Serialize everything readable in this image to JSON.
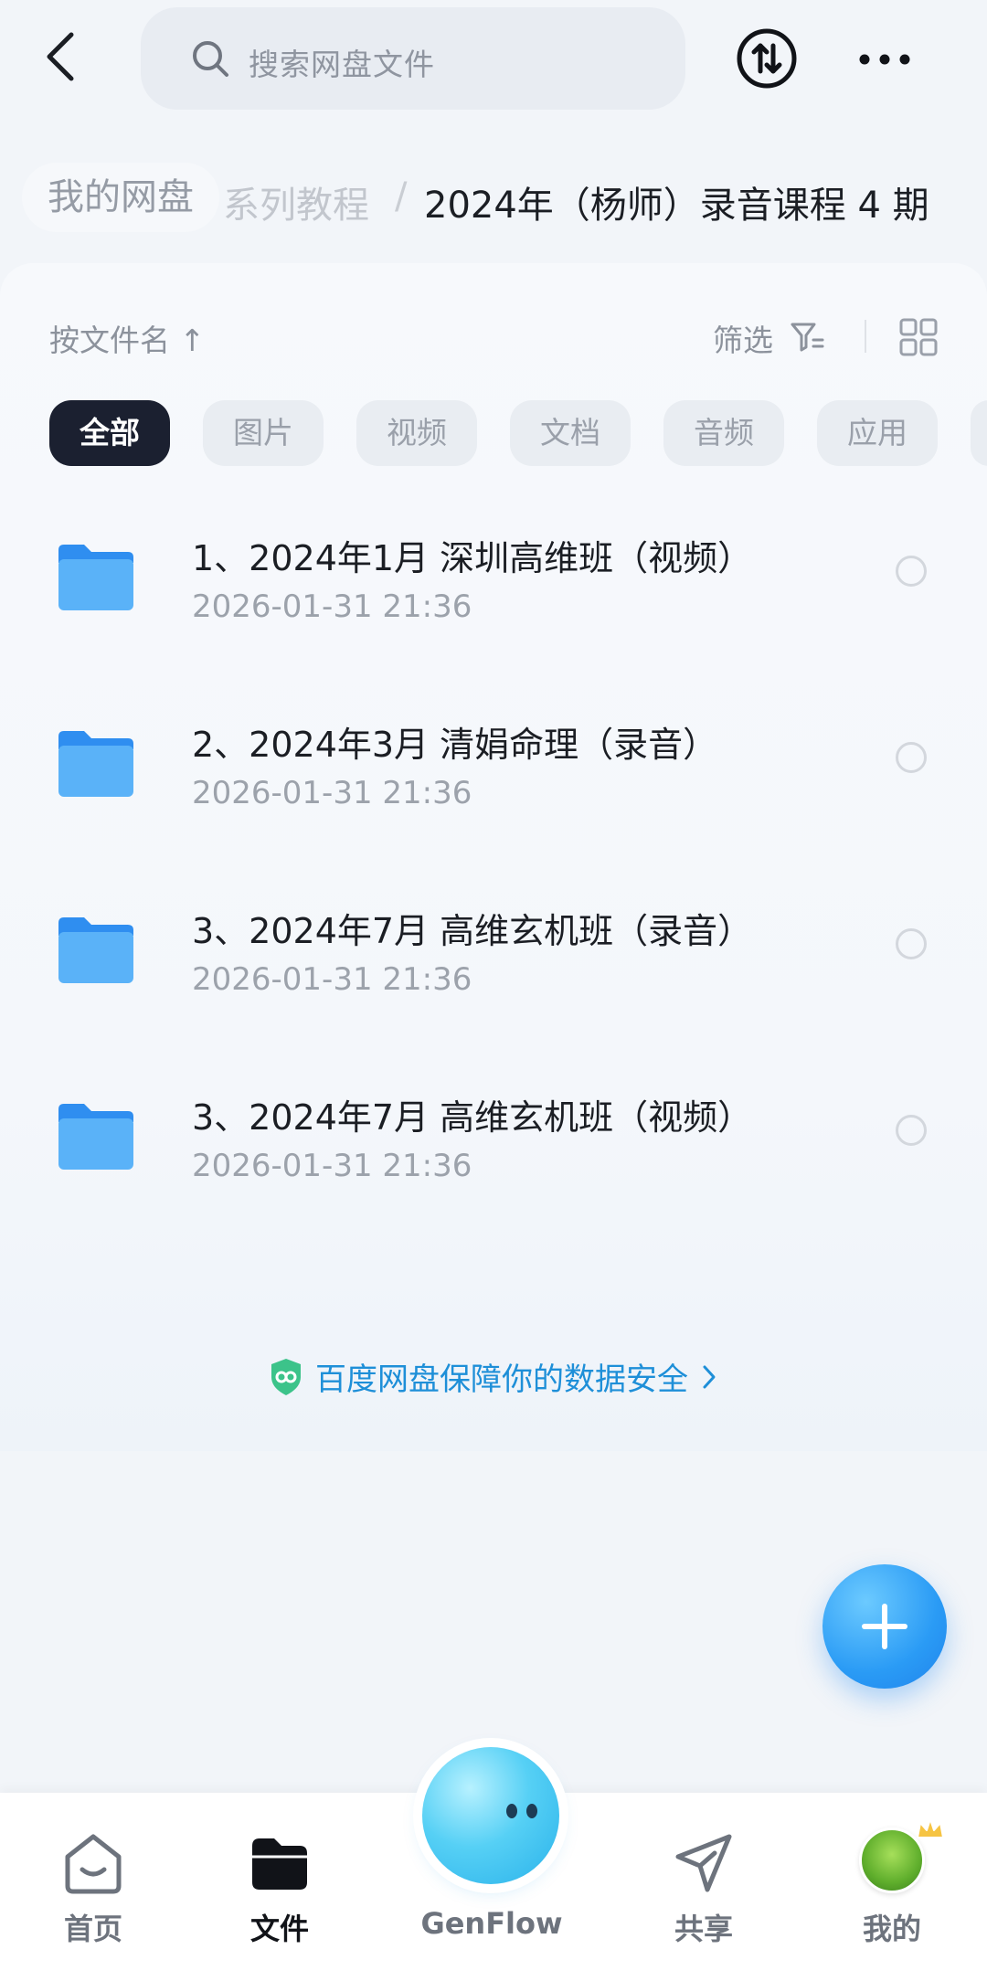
{
  "header": {
    "search_placeholder": "搜索网盘文件",
    "icons": [
      "back-icon",
      "search-icon",
      "transfer-icon",
      "more-icon"
    ]
  },
  "breadcrumb": {
    "root": "我的网盘",
    "middle": "系列教程",
    "separator": "/",
    "current": "2024年（杨师）录音课程 4 期"
  },
  "toolbar": {
    "sort_label": "按文件名 ↑",
    "filter_label": "筛选"
  },
  "tabs": [
    {
      "label": "全部",
      "active": true
    },
    {
      "label": "图片",
      "active": false
    },
    {
      "label": "视频",
      "active": false
    },
    {
      "label": "文档",
      "active": false
    },
    {
      "label": "音频",
      "active": false
    },
    {
      "label": "应用",
      "active": false
    }
  ],
  "files": [
    {
      "name": "1、2024年1月 深圳高维班（视频）",
      "date": "2026-01-31  21:36"
    },
    {
      "name": "2、2024年3月 清娟命理（录音）",
      "date": "2026-01-31  21:36"
    },
    {
      "name": "3、2024年7月 高维玄机班（录音）",
      "date": "2026-01-31  21:36"
    },
    {
      "name": "3、2024年7月 高维玄机班（视频）",
      "date": "2026-01-31  21:36"
    }
  ],
  "security_text": "百度网盘保障你的数据安全",
  "bottom_nav": [
    {
      "label": "首页",
      "icon": "home-icon",
      "active": false
    },
    {
      "label": "文件",
      "icon": "folder-icon",
      "active": true
    },
    {
      "label": "GenFlow",
      "icon": "genflow-icon",
      "active": false
    },
    {
      "label": "共享",
      "icon": "share-icon",
      "active": false
    },
    {
      "label": "我的",
      "icon": "avatar-icon",
      "active": false
    }
  ],
  "colors": {
    "accent": "#2a9bf5",
    "security_text": "#1e8fd8",
    "active_tab_bg": "#1b2030",
    "folder": "#4aa8f7"
  }
}
